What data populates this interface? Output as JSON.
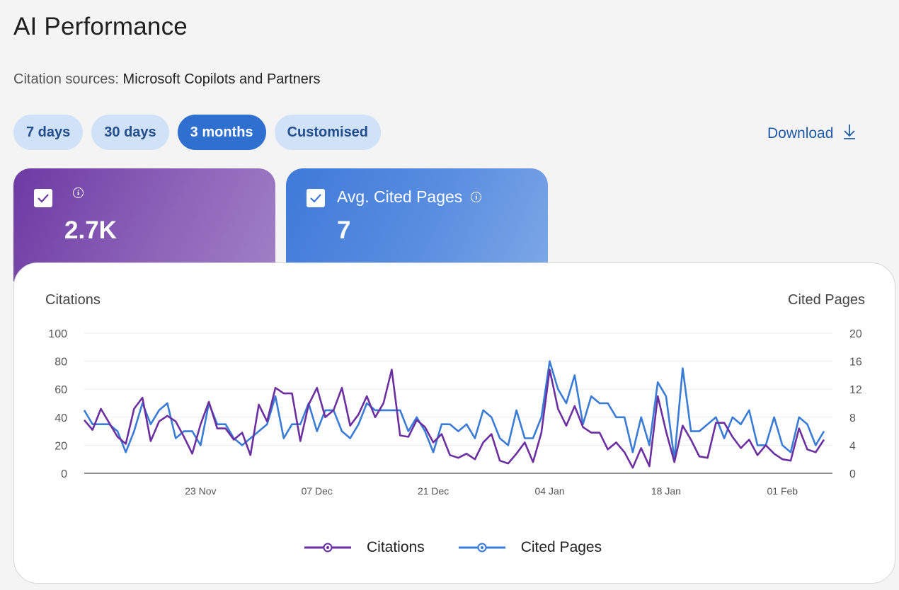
{
  "page": {
    "title": "AI Performance"
  },
  "sources": {
    "label": "Citation sources:",
    "value": "Microsoft Copilots and Partners"
  },
  "ranges": [
    {
      "label": "7 days",
      "active": false
    },
    {
      "label": "30 days",
      "active": false
    },
    {
      "label": "3 months",
      "active": true
    },
    {
      "label": "Customised",
      "active": false
    }
  ],
  "download": {
    "label": "Download",
    "icon": "download-icon"
  },
  "cards": {
    "citations": {
      "label": "",
      "value": "2.7K",
      "checked": true
    },
    "cited_pages": {
      "label": "Avg. Cited Pages",
      "value": "7",
      "checked": true
    }
  },
  "colors": {
    "citations": "#6b2fa0",
    "cited_pages": "#3a7bd5",
    "gridline": "#ececec"
  },
  "chart_data": {
    "type": "line",
    "left_axis": {
      "label": "Citations",
      "ticks": [
        0,
        20,
        40,
        60,
        80,
        100
      ],
      "range": [
        0,
        100
      ]
    },
    "right_axis": {
      "label": "Cited Pages",
      "ticks": [
        0,
        4,
        8,
        12,
        16,
        20
      ],
      "range": [
        0,
        20
      ]
    },
    "x_tick_labels": [
      "23 Nov",
      "07 Dec",
      "21 Dec",
      "04 Jan",
      "18 Jan",
      "01 Feb"
    ],
    "x_tick_day_index": [
      14,
      28,
      42,
      56,
      70,
      84
    ],
    "series": [
      {
        "name": "Citations",
        "axis": "left",
        "values": [
          38,
          31,
          46,
          36,
          26,
          21,
          46,
          54,
          23,
          37,
          41,
          37,
          26,
          14,
          35,
          51,
          32,
          32,
          24,
          29,
          13,
          49,
          37,
          61,
          57,
          57,
          23,
          49,
          61,
          40,
          45,
          61,
          34,
          42,
          55,
          40,
          50,
          74,
          27,
          26,
          38,
          33,
          22,
          28,
          13,
          11,
          14,
          10,
          22,
          28,
          9,
          7,
          14,
          22,
          8,
          29,
          74,
          46,
          34,
          48,
          33,
          29,
          29,
          17,
          22,
          15,
          4,
          18,
          5,
          55,
          30,
          8,
          34,
          24,
          12,
          11,
          36,
          36,
          26,
          18,
          24,
          13,
          20,
          14,
          10,
          9,
          32,
          17,
          15,
          24
        ]
      },
      {
        "name": "Cited Pages",
        "axis": "right",
        "values": [
          9,
          7,
          7,
          7,
          6,
          3,
          6,
          10,
          7,
          9,
          10,
          5,
          6,
          6,
          4,
          10,
          7,
          7,
          5,
          4,
          5,
          6,
          7,
          11,
          5,
          7,
          7,
          10,
          6,
          9,
          9,
          6,
          5,
          7,
          10,
          9,
          9,
          9,
          9,
          6,
          8,
          6,
          3,
          7,
          7,
          6,
          7,
          5,
          9,
          8,
          5,
          4,
          9,
          5,
          5,
          8,
          16,
          12,
          10,
          14,
          7,
          11,
          10,
          10,
          8,
          8,
          3,
          8,
          4,
          13,
          11,
          2,
          15,
          6,
          6,
          7,
          8,
          5,
          8,
          7,
          9,
          4,
          4,
          8,
          4,
          3,
          8,
          7,
          4,
          6
        ]
      }
    ]
  },
  "legend": [
    {
      "label": "Citations"
    },
    {
      "label": "Cited Pages"
    }
  ]
}
